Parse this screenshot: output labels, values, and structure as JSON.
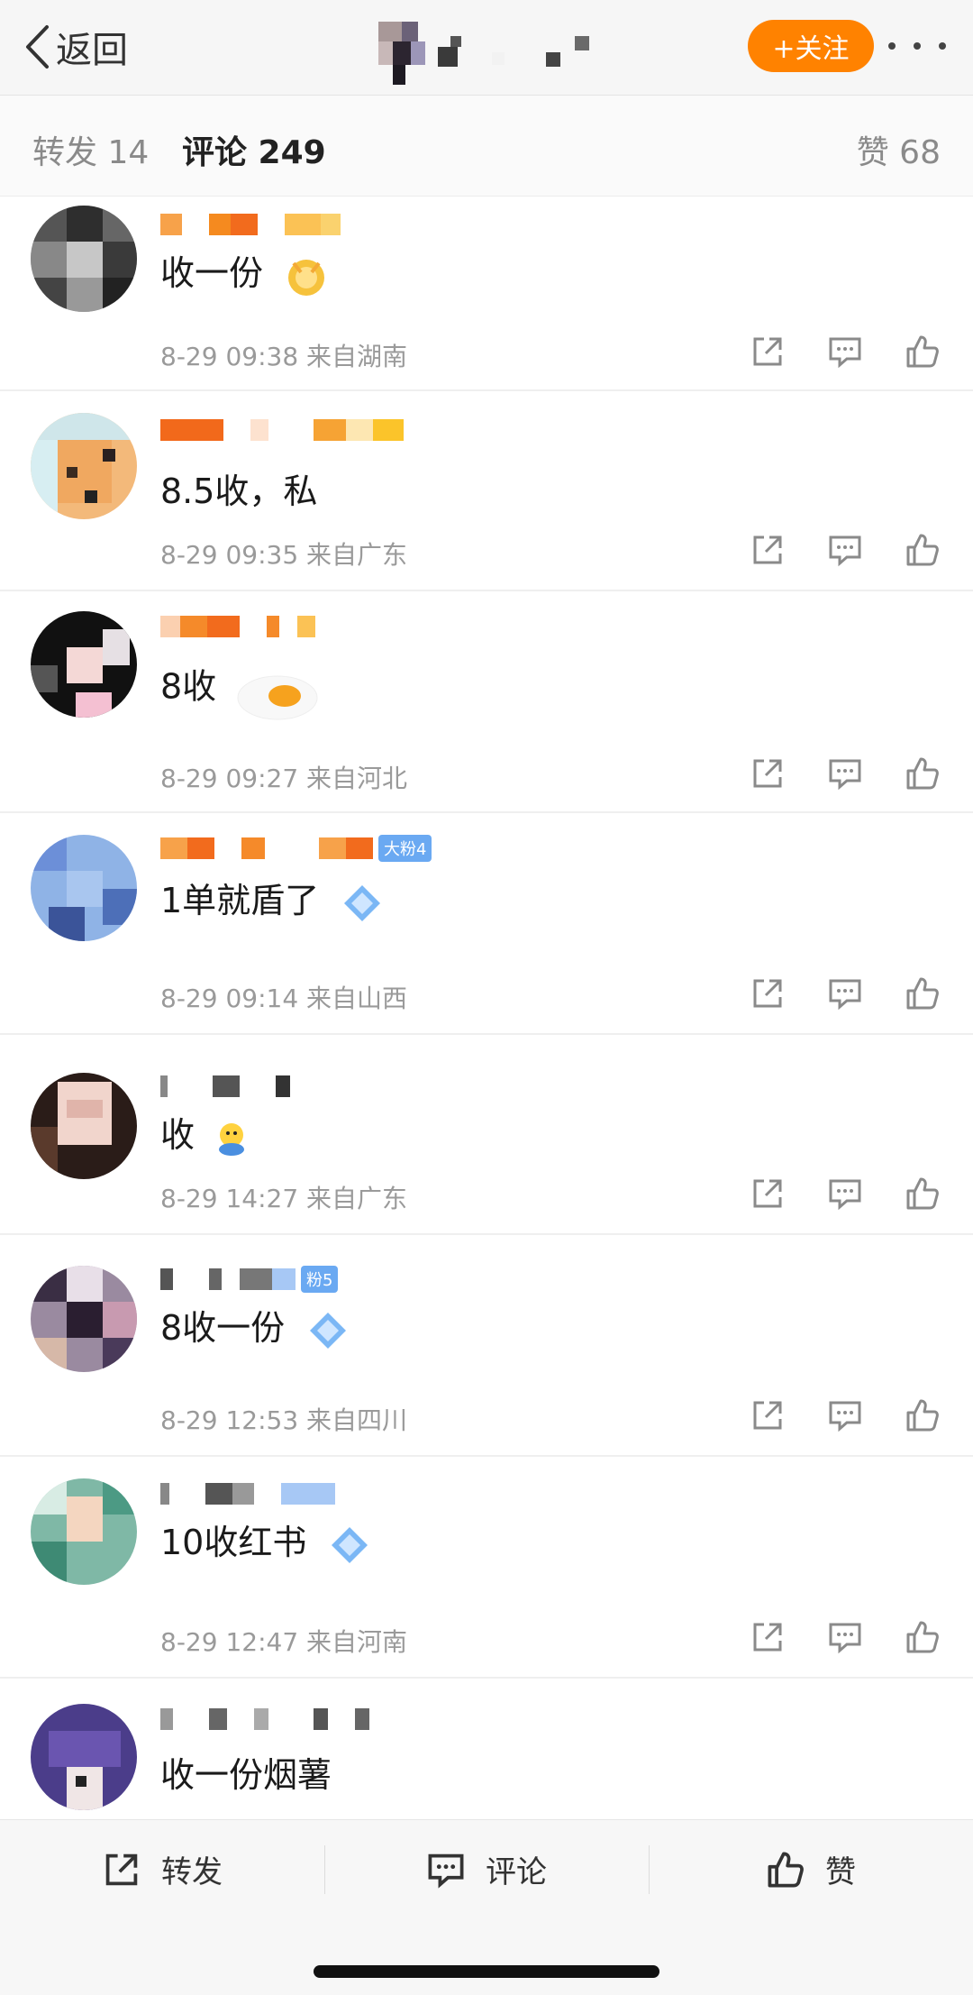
{
  "nav": {
    "back_label": "返回",
    "follow_label": "+关注"
  },
  "tabs": {
    "repost": "转发 14",
    "comment": "评论 249",
    "like": "赞 68"
  },
  "comments": [
    {
      "text": "收一份",
      "time": "8-29 09:38",
      "location": "来自湖南"
    },
    {
      "text": "8.5收，私",
      "time": "8-29 09:35",
      "location": "来自广东"
    },
    {
      "text": "8收",
      "time": "8-29 09:27",
      "location": "来自河北"
    },
    {
      "text": "1单就盾了",
      "time": "8-29 09:14",
      "location": "来自山西",
      "badge": "大粉4"
    },
    {
      "text": "收",
      "time": "8-29 14:27",
      "location": "来自广东"
    },
    {
      "text": "8收一份",
      "time": "8-29 12:53",
      "location": "来自四川",
      "badge": "粉5"
    },
    {
      "text": "10收红书",
      "time": "8-29 12:47",
      "location": "来自河南"
    },
    {
      "text": "收一份烟薯"
    }
  ],
  "icons": {
    "repost": "share-icon",
    "comment": "comment-icon",
    "like": "thumbs-up-icon"
  },
  "bottom_bar": {
    "repost": "转发",
    "comment": "评论",
    "like": "赞"
  },
  "colors": {
    "accent": "#ff8200",
    "text": "#222222",
    "meta": "#9a9a9a"
  }
}
